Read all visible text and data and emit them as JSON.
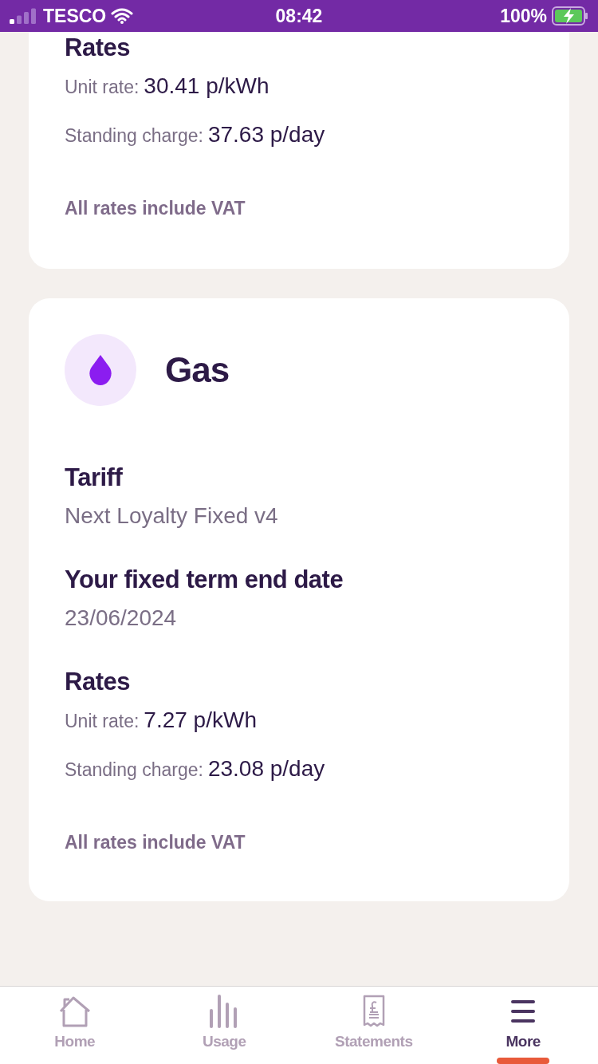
{
  "status_bar": {
    "carrier": "TESCO",
    "time": "08:42",
    "battery": "100%"
  },
  "cards": [
    {
      "sections": [
        {
          "kind": "rates",
          "heading": "Rates",
          "rows": [
            {
              "label": "Unit rate:",
              "value": "30.41 p/kWh"
            },
            {
              "label": "Standing charge:",
              "value": "37.63 p/day"
            }
          ],
          "note": "All rates include VAT"
        }
      ]
    },
    {
      "kind": "gas",
      "title": "Gas",
      "sections": [
        {
          "kind": "info",
          "heading": "Tariff",
          "value": "Next Loyalty Fixed v4"
        },
        {
          "kind": "info",
          "heading": "Your fixed term end date",
          "value": "23/06/2024"
        },
        {
          "kind": "rates",
          "heading": "Rates",
          "rows": [
            {
              "label": "Unit rate:",
              "value": "7.27 p/kWh"
            },
            {
              "label": "Standing charge:",
              "value": "23.08 p/day"
            }
          ],
          "note": "All rates include VAT"
        }
      ]
    }
  ],
  "tabs": [
    {
      "kind": "home",
      "label": "Home",
      "selected": false
    },
    {
      "kind": "usage",
      "label": "Usage",
      "selected": false
    },
    {
      "kind": "statements",
      "label": "Statements",
      "selected": false
    },
    {
      "kind": "more",
      "label": "More",
      "selected": true
    }
  ]
}
